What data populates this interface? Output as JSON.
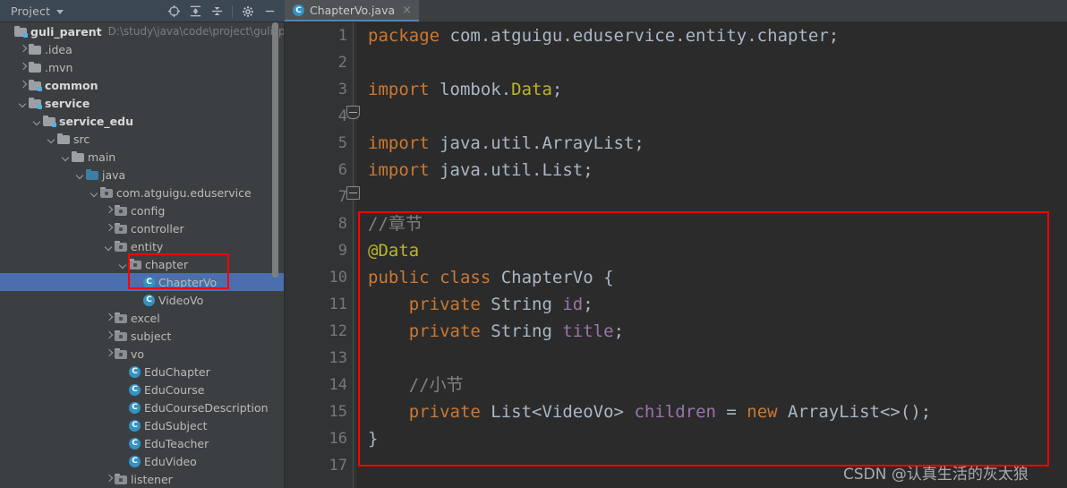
{
  "tool_window": {
    "title": "Project",
    "caret_icon": "chevron-down-icon",
    "icons": [
      {
        "name": "locate-target-icon",
        "glyph": "target"
      },
      {
        "name": "expand-all-icon",
        "glyph": "expand"
      },
      {
        "name": "collapse-all-icon",
        "glyph": "collapse"
      },
      {
        "name": "settings-gear-icon",
        "glyph": "gear"
      },
      {
        "name": "hide-minimize-icon",
        "glyph": "minus"
      }
    ]
  },
  "editor_tabs": [
    {
      "label": "ChapterVo.java",
      "icon": "java-class-icon",
      "badge": "C",
      "close": "×",
      "active": true
    }
  ],
  "tree": {
    "root": {
      "label": "guli_parent",
      "path": "D:\\study\\java\\code\\project\\guli_paren"
    },
    "items": [
      {
        "label": "guli_parent",
        "path": "D:\\study\\java\\code\\project\\guli_paren",
        "indent": 0,
        "arrow": "none",
        "icon": "module-folder-icon",
        "bold": true,
        "selected": false
      },
      {
        "label": ".idea",
        "indent": 1,
        "arrow": "right",
        "icon": "folder-icon",
        "bold": false,
        "selected": false
      },
      {
        "label": ".mvn",
        "indent": 1,
        "arrow": "right",
        "icon": "folder-icon",
        "bold": false,
        "selected": false
      },
      {
        "label": "common",
        "indent": 1,
        "arrow": "right",
        "icon": "module-folder-icon",
        "bold": true,
        "selected": false
      },
      {
        "label": "service",
        "indent": 1,
        "arrow": "down",
        "icon": "module-folder-icon",
        "bold": true,
        "selected": false
      },
      {
        "label": "service_edu",
        "indent": 2,
        "arrow": "down",
        "icon": "module-folder-icon",
        "bold": true,
        "selected": false
      },
      {
        "label": "src",
        "indent": 3,
        "arrow": "down",
        "icon": "folder-icon",
        "bold": false,
        "selected": false
      },
      {
        "label": "main",
        "indent": 4,
        "arrow": "down",
        "icon": "folder-icon",
        "bold": false,
        "selected": false
      },
      {
        "label": "java",
        "indent": 5,
        "arrow": "down",
        "icon": "source-root-icon",
        "bold": false,
        "selected": false
      },
      {
        "label": "com.atguigu.eduservice",
        "indent": 6,
        "arrow": "down",
        "icon": "package-icon",
        "bold": false,
        "selected": false
      },
      {
        "label": "config",
        "indent": 7,
        "arrow": "right",
        "icon": "package-icon",
        "bold": false,
        "selected": false
      },
      {
        "label": "controller",
        "indent": 7,
        "arrow": "right",
        "icon": "package-icon",
        "bold": false,
        "selected": false
      },
      {
        "label": "entity",
        "indent": 7,
        "arrow": "down",
        "icon": "package-icon",
        "bold": false,
        "selected": false
      },
      {
        "label": "chapter",
        "indent": 8,
        "arrow": "down",
        "icon": "package-icon",
        "bold": false,
        "selected": false
      },
      {
        "label": "ChapterVo",
        "indent": 9,
        "arrow": "none",
        "icon": "java-class-icon",
        "bold": false,
        "selected": true
      },
      {
        "label": "VideoVo",
        "indent": 9,
        "arrow": "none",
        "icon": "java-class-icon",
        "bold": false,
        "selected": false
      },
      {
        "label": "excel",
        "indent": 7,
        "arrow": "right",
        "icon": "package-icon",
        "bold": false,
        "selected": false
      },
      {
        "label": "subject",
        "indent": 7,
        "arrow": "right",
        "icon": "package-icon",
        "bold": false,
        "selected": false
      },
      {
        "label": "vo",
        "indent": 7,
        "arrow": "right",
        "icon": "package-icon",
        "bold": false,
        "selected": false
      },
      {
        "label": "EduChapter",
        "indent": 8,
        "arrow": "none",
        "icon": "java-class-icon",
        "bold": false,
        "selected": false
      },
      {
        "label": "EduCourse",
        "indent": 8,
        "arrow": "none",
        "icon": "java-class-icon",
        "bold": false,
        "selected": false
      },
      {
        "label": "EduCourseDescription",
        "indent": 8,
        "arrow": "none",
        "icon": "java-class-icon",
        "bold": false,
        "selected": false
      },
      {
        "label": "EduSubject",
        "indent": 8,
        "arrow": "none",
        "icon": "java-class-icon",
        "bold": false,
        "selected": false
      },
      {
        "label": "EduTeacher",
        "indent": 8,
        "arrow": "none",
        "icon": "java-class-icon",
        "bold": false,
        "selected": false
      },
      {
        "label": "EduVideo",
        "indent": 8,
        "arrow": "none",
        "icon": "java-class-icon",
        "bold": false,
        "selected": false
      },
      {
        "label": "listener",
        "indent": 7,
        "arrow": "right",
        "icon": "package-icon",
        "bold": false,
        "selected": false
      }
    ]
  },
  "editor": {
    "line_numbers": [
      "1",
      "2",
      "3",
      "4",
      "5",
      "6",
      "7",
      "8",
      "9",
      "10",
      "11",
      "12",
      "13",
      "14",
      "15",
      "16",
      "17"
    ],
    "lines": [
      {
        "n": "1",
        "tokens": [
          {
            "t": "package ",
            "c": "kw"
          },
          {
            "t": "com.atguigu.eduservice.entity.chapter;",
            "c": "plain"
          }
        ]
      },
      {
        "n": "2",
        "tokens": []
      },
      {
        "n": "3",
        "tokens": [
          {
            "t": "import ",
            "c": "kw"
          },
          {
            "t": "lombok.",
            "c": "plain"
          },
          {
            "t": "Data",
            "c": "anno"
          },
          {
            "t": ";",
            "c": "plain"
          }
        ]
      },
      {
        "n": "4",
        "tokens": []
      },
      {
        "n": "5",
        "tokens": [
          {
            "t": "import ",
            "c": "kw"
          },
          {
            "t": "java.util.ArrayList;",
            "c": "plain"
          }
        ]
      },
      {
        "n": "6",
        "tokens": [
          {
            "t": "import ",
            "c": "kw"
          },
          {
            "t": "java.util.List;",
            "c": "plain"
          }
        ]
      },
      {
        "n": "7",
        "tokens": []
      },
      {
        "n": "8",
        "tokens": [
          {
            "t": "//章节",
            "c": "cmt"
          }
        ]
      },
      {
        "n": "9",
        "tokens": [
          {
            "t": "@Data",
            "c": "anno"
          }
        ]
      },
      {
        "n": "10",
        "tokens": [
          {
            "t": "public class ",
            "c": "kw"
          },
          {
            "t": "ChapterVo ",
            "c": "cname"
          },
          {
            "t": "{",
            "c": "plain"
          }
        ]
      },
      {
        "n": "11",
        "tokens": [
          {
            "t": "    private ",
            "c": "kw"
          },
          {
            "t": "String ",
            "c": "plain"
          },
          {
            "t": "id",
            "c": "fld2"
          },
          {
            "t": ";",
            "c": "plain"
          }
        ]
      },
      {
        "n": "12",
        "tokens": [
          {
            "t": "    private ",
            "c": "kw"
          },
          {
            "t": "String ",
            "c": "plain"
          },
          {
            "t": "title",
            "c": "fld2"
          },
          {
            "t": ";",
            "c": "plain"
          }
        ]
      },
      {
        "n": "13",
        "tokens": []
      },
      {
        "n": "14",
        "tokens": [
          {
            "t": "    //小节",
            "c": "cmt"
          }
        ]
      },
      {
        "n": "15",
        "tokens": [
          {
            "t": "    private ",
            "c": "kw"
          },
          {
            "t": "List<VideoVo> ",
            "c": "plain"
          },
          {
            "t": "children ",
            "c": "fld2"
          },
          {
            "t": "= ",
            "c": "plain"
          },
          {
            "t": "new ",
            "c": "kw"
          },
          {
            "t": "ArrayList<>();",
            "c": "plain"
          }
        ]
      },
      {
        "n": "16",
        "tokens": [
          {
            "t": "}",
            "c": "plain"
          }
        ]
      },
      {
        "n": "17",
        "tokens": []
      }
    ]
  },
  "watermark": {
    "text": "CSDN @认真生活的灰太狼"
  },
  "colors": {
    "accent_blue": "#4b6eaf",
    "highlight_red": "#ff0000",
    "editor_bg": "#2b2b2b",
    "panel_bg": "#3c3f41",
    "gutter_bg": "#313335",
    "keyword": "#cc7832",
    "annotation": "#bbb529",
    "field": "#9876aa",
    "comment": "#808080",
    "text": "#a9b7c6"
  }
}
